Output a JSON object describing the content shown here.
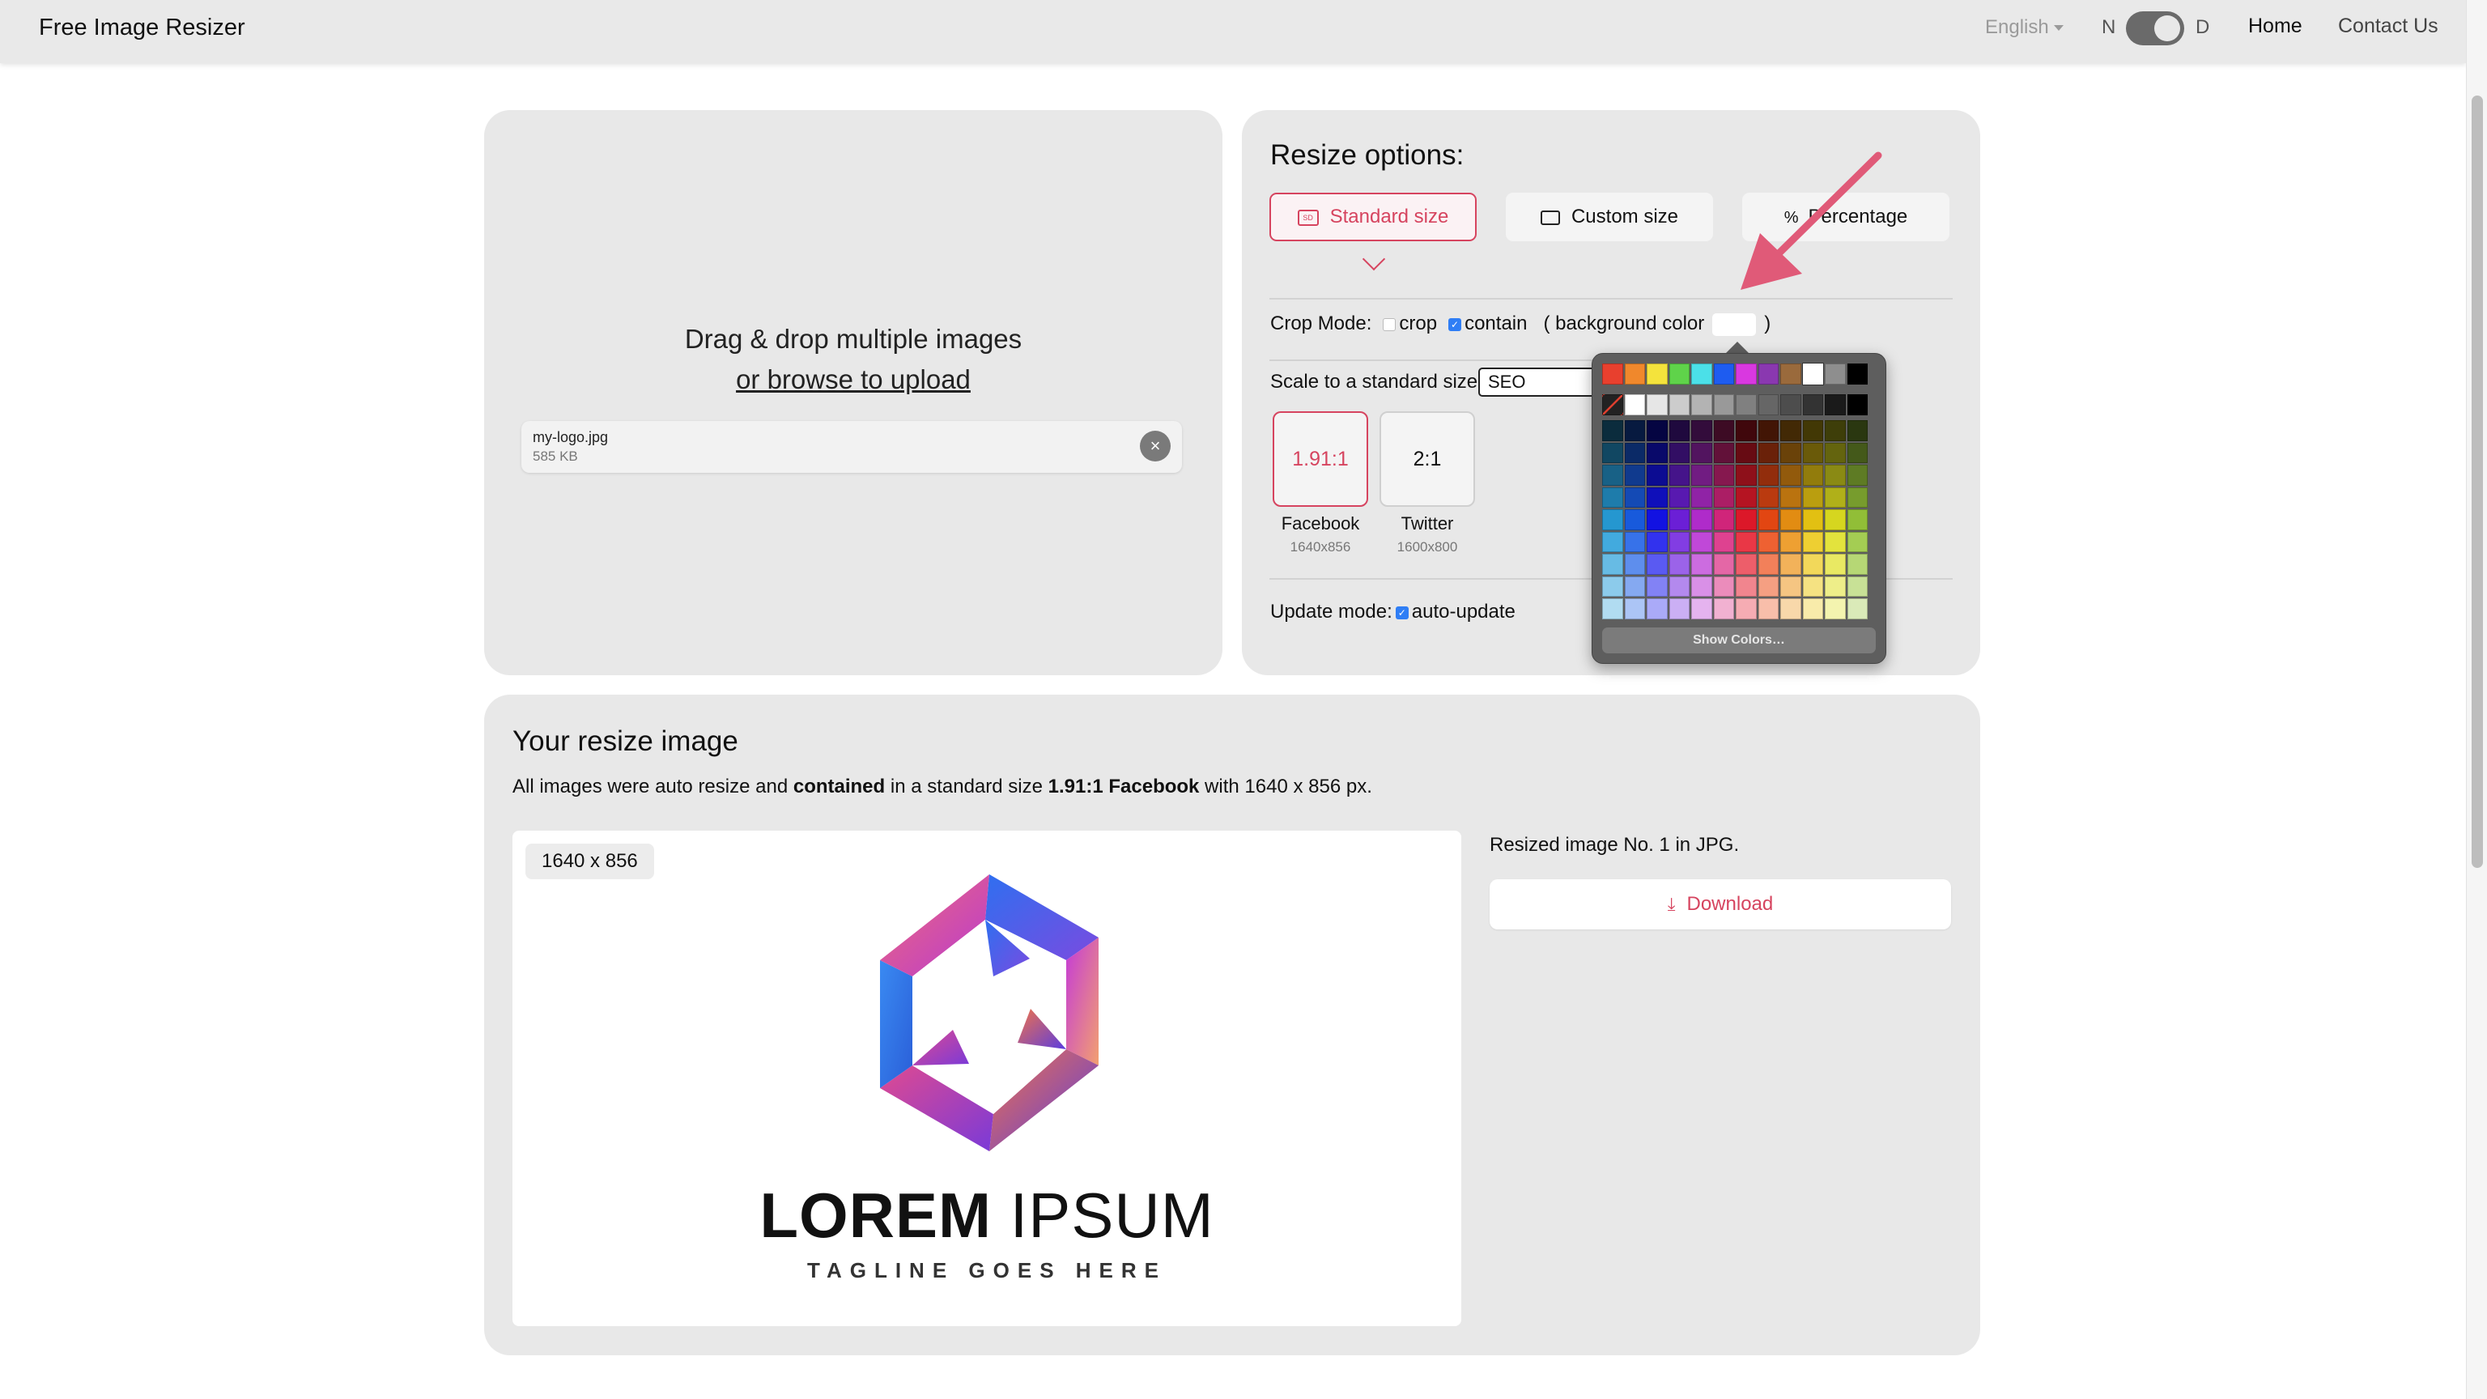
{
  "navbar": {
    "brand": "Free Image Resizer",
    "language": "English",
    "mode_left": "N",
    "mode_right": "D",
    "home": "Home",
    "contact": "Contact Us"
  },
  "upload": {
    "drop_line1": "Drag & drop multiple images",
    "drop_line2": "or browse to upload",
    "file": {
      "name": "my-logo.jpg",
      "size": "585 KB",
      "remove_glyph": "×"
    }
  },
  "options": {
    "title": "Resize options:",
    "buttons": {
      "standard": "Standard size",
      "custom": "Custom size",
      "percentage": "Percentage",
      "standard_icon_text": "SD",
      "percentage_icon": "%"
    },
    "crop_mode": {
      "label": "Crop Mode:",
      "crop": "crop",
      "contain": "contain",
      "bg_open": "( background color",
      "bg_close": ")"
    },
    "scale": {
      "label": "Scale to a standard size",
      "selected": "SEO"
    },
    "sizes": [
      {
        "ratio": "1.91:1",
        "name": "Facebook",
        "dims": "1640x856"
      },
      {
        "ratio": "2:1",
        "name": "Twitter",
        "dims": "1600x800"
      }
    ],
    "update": {
      "label": "Update mode:",
      "value": "auto-update"
    }
  },
  "color_picker": {
    "show_colors": "Show Colors…",
    "top_row": [
      "#e8402e",
      "#f0882c",
      "#f4e33c",
      "#5fd34a",
      "#4be0e8",
      "#1e5cf0",
      "#d938e0",
      "#8a38b0",
      "#9a6a3c",
      "#ffffff",
      "#8e8e8e",
      "#000000"
    ],
    "gray_row": [
      "#ffffff",
      "#e6e6e6",
      "#cccccc",
      "#b3b3b3",
      "#999999",
      "#808080",
      "#666666",
      "#4d4d4d",
      "#333333",
      "#1a1a1a",
      "#000000"
    ]
  },
  "result": {
    "title": "Your resize image",
    "desc_1": "All images were auto resize and ",
    "desc_bold1": "contained",
    "desc_2": " in a standard size ",
    "desc_bold2": "1.91:1 Facebook",
    "desc_3": " with 1640 x 856 px.",
    "dim_badge": "1640 x 856",
    "logo_word1": "LOREM",
    "logo_word2": "IPSUM",
    "tagline": "TAGLINE GOES HERE",
    "resized_label": "Resized image No. 1 in JPG.",
    "download": "Download"
  },
  "colors": {
    "accent": "#d6445f",
    "checkbox": "#2f7ef5",
    "panel": "#e8e8e8",
    "arrow": "#e05a78"
  }
}
